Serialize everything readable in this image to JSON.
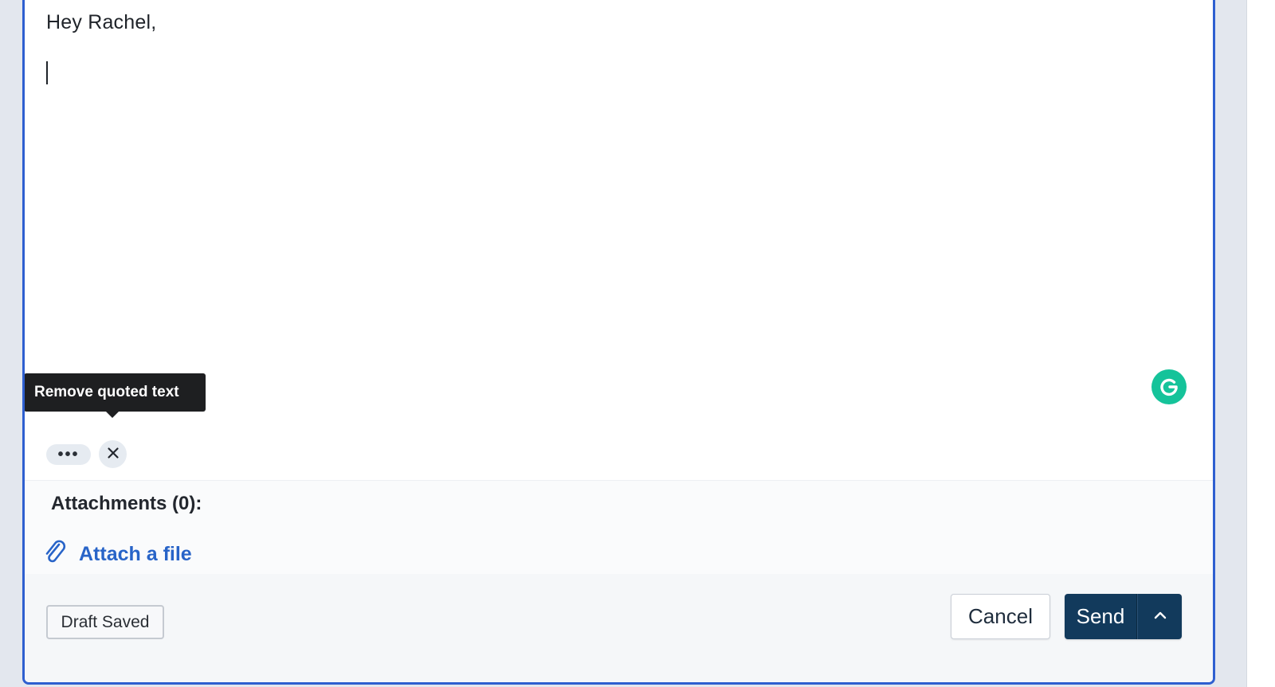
{
  "editor": {
    "greeting": "Hey Rachel,"
  },
  "tooltip": {
    "text": "Remove quoted text"
  },
  "quoted_text": {
    "expand_label": "•••"
  },
  "attachments": {
    "heading": "Attachments (0):",
    "attach_label": "Attach a file"
  },
  "footer": {
    "draft_status": "Draft Saved",
    "cancel_label": "Cancel",
    "send_label": "Send"
  },
  "colors": {
    "accent_border": "#2e5fd0",
    "send_button": "#123a5c",
    "link": "#2864c8",
    "grammarly": "#15c39a"
  },
  "icons": [
    "grammarly-icon",
    "close-icon",
    "paperclip-icon",
    "chevron-up-icon"
  ]
}
